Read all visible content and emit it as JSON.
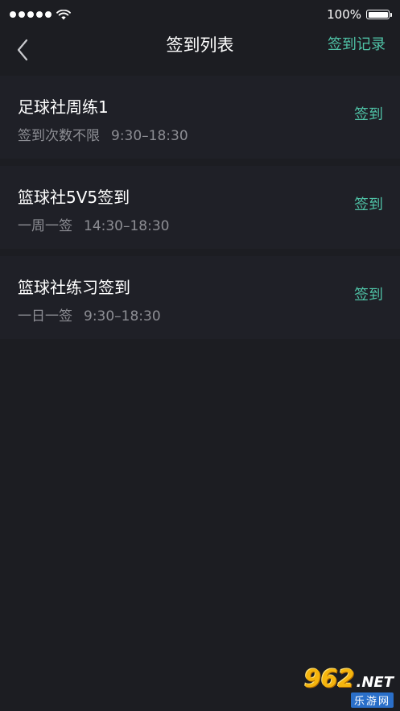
{
  "status_bar": {
    "battery_text": "100%",
    "battery_level": 1.0,
    "signal_icon": "signal-dots-icon",
    "wifi_icon": "wifi-icon",
    "battery_icon": "battery-icon"
  },
  "nav": {
    "title": "签到列表",
    "right_action": "签到记录",
    "back_icon": "chevron-left-icon"
  },
  "items": [
    {
      "title": "足球社周练1",
      "frequency": "签到次数不限",
      "time": "9:30–18:30",
      "action": "签到"
    },
    {
      "title": "篮球社5V5签到",
      "frequency": "一周一签",
      "time": "14:30–18:30",
      "action": "签到"
    },
    {
      "title": "篮球社练习签到",
      "frequency": "一日一签",
      "time": "9:30–18:30",
      "action": "签到"
    }
  ],
  "watermark": {
    "brand": "962",
    "domain_suffix": ".NET",
    "site_name": "乐游网"
  },
  "colors": {
    "background": "#1c1d22",
    "card": "#1f2027",
    "accent": "#4fc2a6",
    "secondary_text": "#8d8e94"
  }
}
